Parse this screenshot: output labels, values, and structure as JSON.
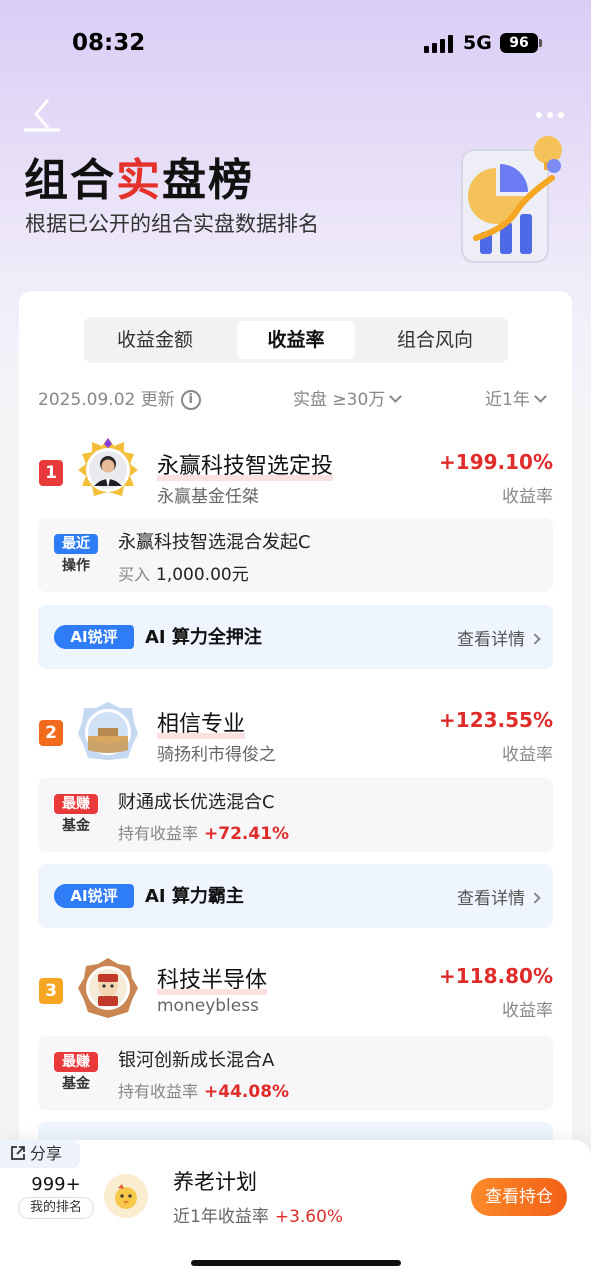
{
  "status_bar": {
    "time": "08:32",
    "network": "5G",
    "battery": "96"
  },
  "header": {
    "title_part1": "组合",
    "title_mark": "实",
    "title_part2": "盘榜",
    "subtitle": "根据已公开的组合实盘数据排名"
  },
  "tabs": [
    {
      "label": "收益金额",
      "active": false
    },
    {
      "label": "收益率",
      "active": true
    },
    {
      "label": "组合风向",
      "active": false
    }
  ],
  "filters": {
    "updated": "2025.09.02 更新",
    "scope": "实盘 ≥30万",
    "period": "近1年"
  },
  "entries": [
    {
      "rank": "1",
      "rank_color": "#e83a3a",
      "name": "永赢科技智选定投",
      "author": "永赢基金任桀",
      "rate": "+199.10%",
      "rate_label": "收益率",
      "op_badge_top": "最近",
      "op_badge_bottom": "操作",
      "op_badge_color": "#2e7cf6",
      "op_fund": "永赢科技智选混合发起C",
      "op_detail_label": "买入",
      "op_detail_value": "1,000.00元",
      "ai_tag": "AI锐评",
      "ai_text": "AI 算力全押注",
      "ai_link": "查看详情"
    },
    {
      "rank": "2",
      "rank_color": "#f26a1b",
      "name": "相信专业",
      "author": "骑扬利市得俊之",
      "rate": "+123.55%",
      "rate_label": "收益率",
      "op_badge_top": "最赚",
      "op_badge_bottom": "基金",
      "op_badge_color": "#e83a3a",
      "op_fund": "财通成长优选混合C",
      "op_detail_label": "持有收益率",
      "op_detail_value": "+72.41%",
      "ai_tag": "AI锐评",
      "ai_text": "AI 算力霸主",
      "ai_link": "查看详情"
    },
    {
      "rank": "3",
      "rank_color": "#f6a623",
      "name": "科技半导体",
      "author": "moneybless",
      "rate": "+118.80%",
      "rate_label": "收益率",
      "op_badge_top": "最赚",
      "op_badge_bottom": "基金",
      "op_badge_color": "#e83a3a",
      "op_fund": "银河创新成长混合A",
      "op_detail_label": "持有收益率",
      "op_detail_value": "+44.08%"
    }
  ],
  "bottom": {
    "share": "分享",
    "my_rank": "999+",
    "my_rank_label": "我的排名",
    "name": "养老计划",
    "sub_label": "近1年收益率",
    "sub_value": "+3.60%",
    "button": "查看持仓"
  }
}
